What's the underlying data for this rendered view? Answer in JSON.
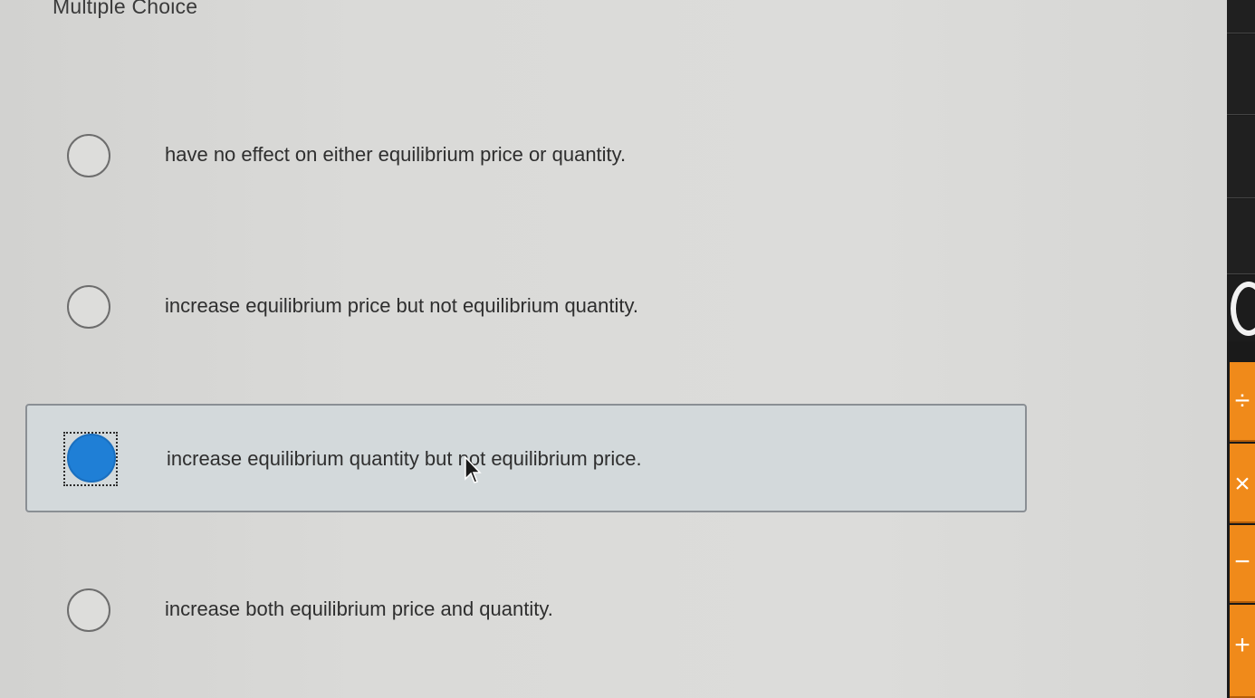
{
  "question": {
    "type_label": "Multiple Choice",
    "options": [
      {
        "label": "have no effect on either equilibrium price or quantity.",
        "selected": false
      },
      {
        "label": "increase equilibrium price but not equilibrium quantity.",
        "selected": false
      },
      {
        "label": "increase equilibrium quantity but not equilibrium price.",
        "selected": true
      },
      {
        "label": "increase both equilibrium price and quantity.",
        "selected": false
      }
    ]
  },
  "calculator": {
    "keys": [
      "÷",
      "×",
      "−",
      "+"
    ],
    "accent_color": "#f08a1a"
  },
  "colors": {
    "radio_selected": "#1f7fd6"
  }
}
